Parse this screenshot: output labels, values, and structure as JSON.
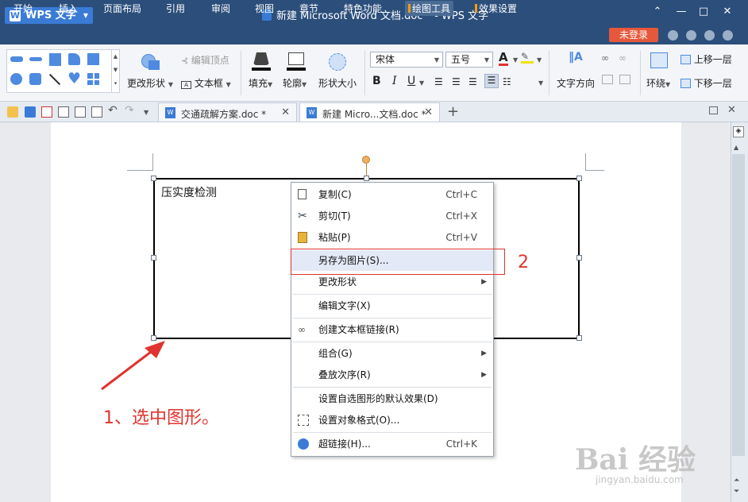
{
  "app": {
    "name": "WPS 文字",
    "doc_title": "新建 Microsoft Word 文档.doc * - WPS 文字"
  },
  "menu": [
    "开始",
    "插入",
    "页面布局",
    "引用",
    "审阅",
    "视图",
    "章节",
    "特色功能",
    "绘图工具",
    "效果设置"
  ],
  "login_label": "未登录",
  "ribbon": {
    "edit_points": "编辑顶点",
    "change_shape": "更改形状",
    "textbox": "文本框",
    "fill": "填充",
    "outline": "轮廓",
    "shape_size": "形状大小",
    "font": "宋体",
    "size": "五号",
    "text_direction": "文字方向",
    "wrap": "环绕",
    "bring_forward": "上移一层",
    "send_backward": "下移一层",
    "bold": "B",
    "italic": "I",
    "underline": "U",
    "font_color_letter": "A"
  },
  "tabs": [
    {
      "label": "交通疏解方案.doc *"
    },
    {
      "label": "新建 Micro...文档.doc *"
    }
  ],
  "textbox_text": "压实度检测",
  "context_menu": [
    {
      "label": "复制(C)",
      "shortcut": "Ctrl+C"
    },
    {
      "label": "剪切(T)",
      "shortcut": "Ctrl+X"
    },
    {
      "label": "粘贴(P)",
      "shortcut": "Ctrl+V"
    },
    {
      "label": "另存为图片(S)..."
    },
    {
      "label": "更改形状"
    },
    {
      "label": "编辑文字(X)"
    },
    {
      "label": "创建文本框链接(R)"
    },
    {
      "label": "组合(G)"
    },
    {
      "label": "叠放次序(R)"
    },
    {
      "label": "设置自选图形的默认效果(D)"
    },
    {
      "label": "设置对象格式(O)..."
    },
    {
      "label": "超链接(H)...",
      "shortcut": "Ctrl+K"
    }
  ],
  "annotations": {
    "step1": "1、选中图形。",
    "step2": "2"
  },
  "watermark": {
    "text": "Bai 经验",
    "url": "jingyan.baidu.com"
  },
  "colors": {
    "title_bar": "#2b4e7b",
    "accent": "#3a7bd5",
    "annotation": "#e0342e",
    "login": "#e6583b",
    "highlight": "#e3e9f6"
  }
}
